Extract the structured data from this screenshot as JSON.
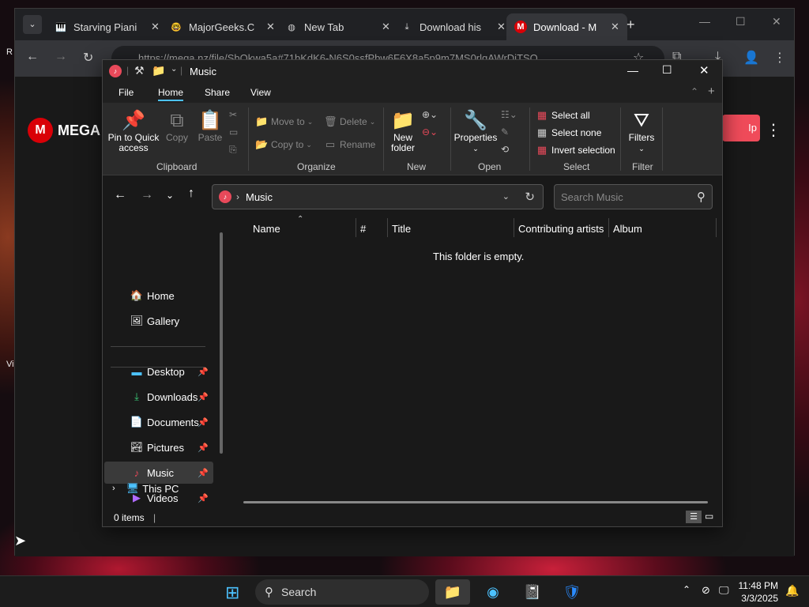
{
  "chrome": {
    "tabs": [
      {
        "label": "Starving Piani",
        "fav": "piano-icon"
      },
      {
        "label": "MajorGeeks.C",
        "fav": "geek-icon"
      },
      {
        "label": "New Tab",
        "fav": "globe-icon"
      },
      {
        "label": "Download his",
        "fav": "download-icon"
      },
      {
        "label": "Download - M",
        "fav": "mega-icon"
      }
    ],
    "url": "https://mega.nz/file/SbQkwa5a#71bKdK6-N6S0ssfPbw6F6X8a5p9m7MS0rlqAWrDjTSQ",
    "mega_logo_text": "MEGA",
    "mega_signup_fragment": "Ip"
  },
  "explorer": {
    "title": "Music",
    "menu": {
      "file": "File",
      "home": "Home",
      "share": "Share",
      "view": "View"
    },
    "ribbon": {
      "pin_line1": "Pin to Quick",
      "pin_line2": "access",
      "copy": "Copy",
      "paste": "Paste",
      "clipboard": "Clipboard",
      "move_to": "Move to",
      "copy_to": "Copy to",
      "delete": "Delete",
      "rename": "Rename",
      "organize": "Organize",
      "new_folder_line1": "New",
      "new_folder_line2": "folder",
      "new": "New",
      "properties": "Properties",
      "open": "Open",
      "select_all": "Select all",
      "select_none": "Select none",
      "invert_selection": "Invert selection",
      "select": "Select",
      "filters": "Filters",
      "filter": "Filter"
    },
    "address": {
      "path": "Music",
      "search_placeholder": "Search Music"
    },
    "nav": {
      "home": "Home",
      "gallery": "Gallery",
      "desktop": "Desktop",
      "downloads": "Downloads",
      "documents": "Documents",
      "pictures": "Pictures",
      "music": "Music",
      "videos": "Videos",
      "this_pc": "This PC"
    },
    "columns": {
      "name": "Name",
      "number": "#",
      "title": "Title",
      "artists": "Contributing artists",
      "album": "Album"
    },
    "empty_message": "This folder is empty.",
    "status": "0 items"
  },
  "taskbar": {
    "search": "Search",
    "time": "11:48 PM",
    "date": "3/3/2025"
  },
  "colors": {
    "accent": "#4cc2ff",
    "mega_red": "#d90007",
    "pin_red": "#e8495a"
  }
}
